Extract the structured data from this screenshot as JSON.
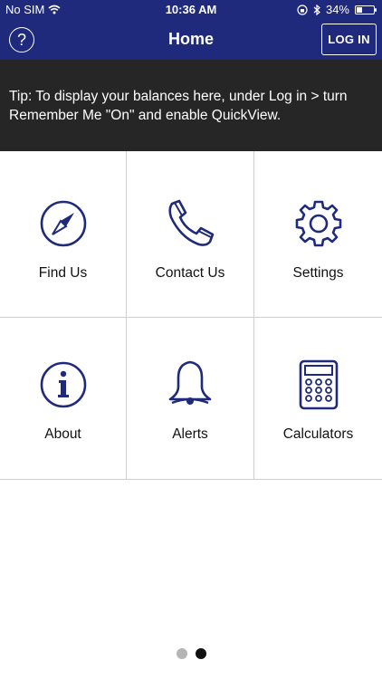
{
  "status_bar": {
    "carrier": "No SIM",
    "time": "10:36 AM",
    "battery": "34%",
    "battery_level": 0.34
  },
  "nav": {
    "title": "Home",
    "help_label": "?",
    "login_label": "LOG IN"
  },
  "tip": {
    "text": "Tip: To display your balances here, under Log in > turn Remember Me \"On\" and enable QuickView."
  },
  "tiles": [
    {
      "label": "Find Us",
      "icon": "compass-icon"
    },
    {
      "label": "Contact Us",
      "icon": "phone-icon"
    },
    {
      "label": "Settings",
      "icon": "gear-icon"
    },
    {
      "label": "About",
      "icon": "info-icon"
    },
    {
      "label": "Alerts",
      "icon": "bell-icon"
    },
    {
      "label": "Calculators",
      "icon": "calculator-icon"
    }
  ],
  "pager": {
    "pages": 2,
    "active_index": 1
  },
  "colors": {
    "brand": "#1f2a7c",
    "tip_background": "#262626",
    "icon_color": "#1f2a7c"
  }
}
